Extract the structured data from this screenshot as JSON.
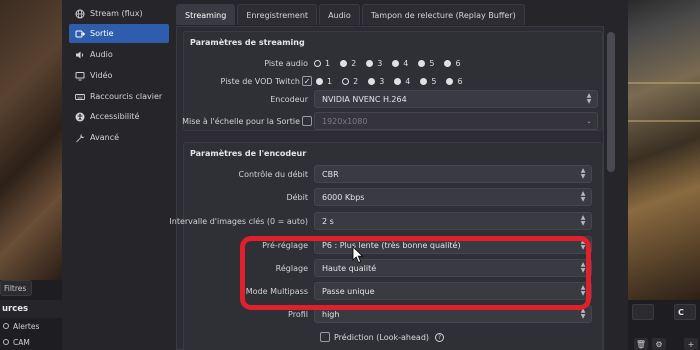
{
  "dialog": {
    "sidebar": {
      "items": [
        {
          "label": "Stream (flux)",
          "icon": "globe-icon",
          "active": false
        },
        {
          "label": "Sortie",
          "icon": "output-icon",
          "active": true
        },
        {
          "label": "Audio",
          "icon": "speaker-icon",
          "active": false
        },
        {
          "label": "Vidéo",
          "icon": "monitor-icon",
          "active": false
        },
        {
          "label": "Raccourcis clavier",
          "icon": "keyboard-icon",
          "active": false
        },
        {
          "label": "Accessibilité",
          "icon": "accessibility-icon",
          "active": false
        },
        {
          "label": "Avancé",
          "icon": "wrench-icon",
          "active": false
        }
      ]
    },
    "tabs": [
      {
        "label": "Streaming",
        "active": true
      },
      {
        "label": "Enregistrement",
        "active": false
      },
      {
        "label": "Audio",
        "active": false
      },
      {
        "label": "Tampon de relecture (Replay Buffer)",
        "active": false
      }
    ],
    "streaming_group": {
      "title": "Paramètres de streaming",
      "audio_track_label": "Piste audio",
      "vod_track_label": "Piste de VOD Twitch",
      "track_numbers": [
        "1",
        "2",
        "3",
        "4",
        "5",
        "6"
      ],
      "selected_audio_track": "1",
      "selected_vod_track": "2",
      "vod_enabled": true,
      "encoder_label": "Encodeur",
      "encoder_value": "NVIDIA NVENC H.264",
      "rescale_label": "Mise à l'échelle pour la Sortie",
      "rescale_enabled": false,
      "rescale_value": "1920x1080"
    },
    "encoder_group": {
      "title": "Paramètres de l'encodeur",
      "rows": [
        {
          "label": "Contrôle du débit",
          "value": "CBR"
        },
        {
          "label": "Débit",
          "value": "6000 Kbps"
        },
        {
          "label": "Intervalle d'images clés (0 = auto)",
          "value": "2 s"
        },
        {
          "label": "Pré-réglage",
          "value": "P6 : Plus lente (très bonne qualité)"
        },
        {
          "label": "Réglage",
          "value": "Haute qualité"
        },
        {
          "label": "Mode Multipass",
          "value": "Passe unique"
        },
        {
          "label": "Profil",
          "value": "high"
        }
      ],
      "lookahead_label": "Prédiction (Look-ahead)",
      "lookahead_enabled": false,
      "help_glyph": "?"
    },
    "highlight_color": "#e0202a",
    "accent_color": "#2e5dad"
  },
  "docks": {
    "filters_label": "Filtres",
    "sources_header": "urces",
    "sources": [
      {
        "label": "Alertes"
      },
      {
        "label": "CAM"
      }
    ],
    "right_header": "C"
  }
}
